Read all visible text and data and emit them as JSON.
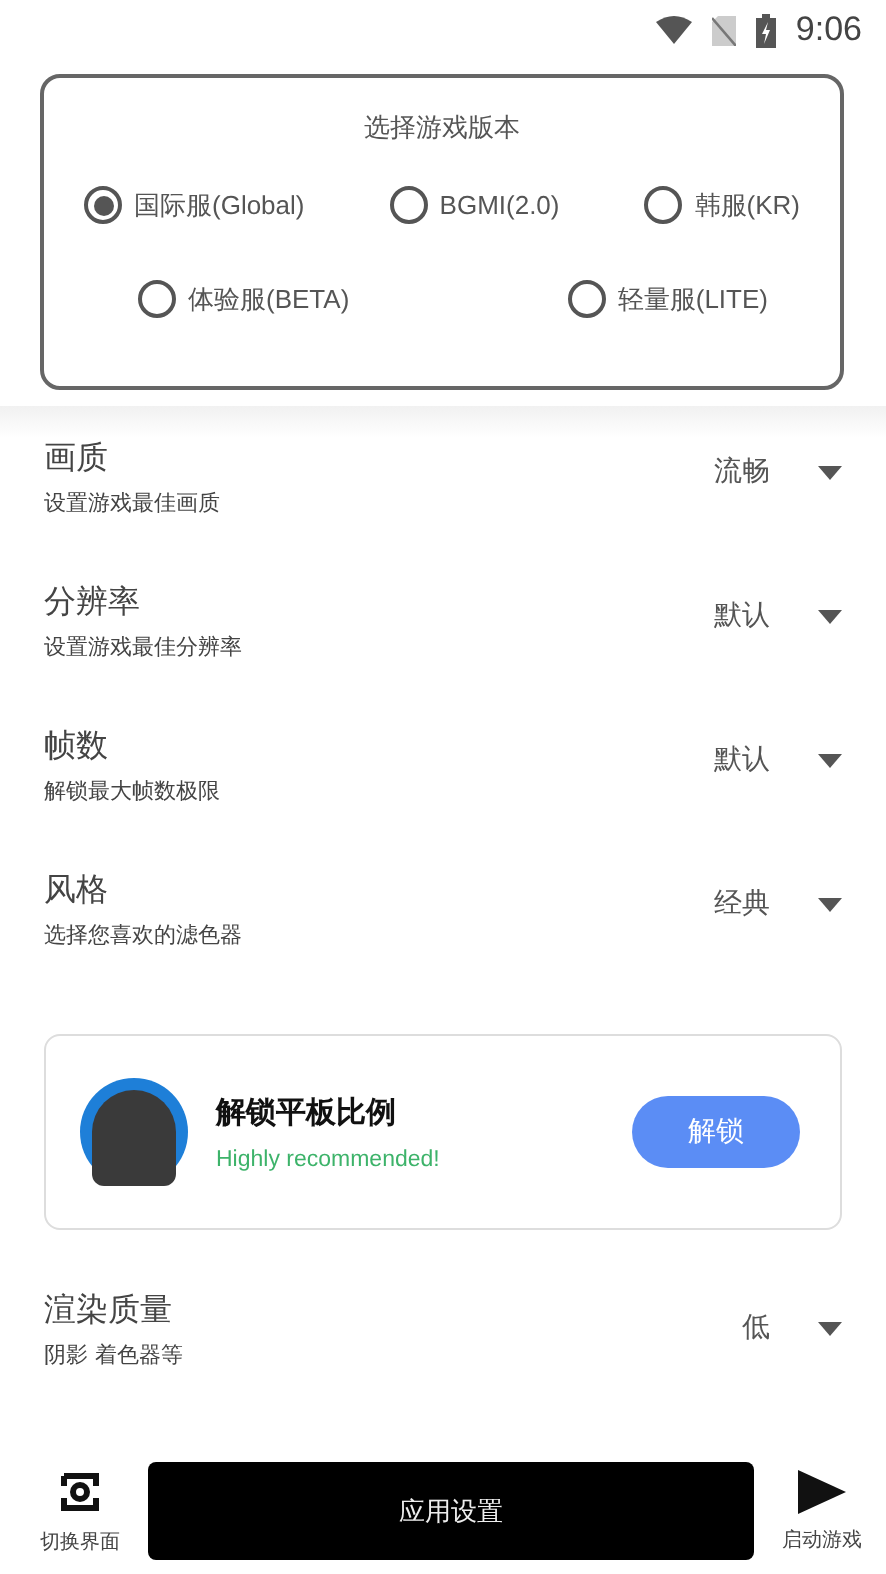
{
  "status_bar": {
    "time": "9:06"
  },
  "version_card": {
    "title": "选择游戏版本",
    "options": [
      {
        "label": "国际服(Global)",
        "selected": true
      },
      {
        "label": "BGMI(2.0)",
        "selected": false
      },
      {
        "label": "韩服(KR)",
        "selected": false
      },
      {
        "label": "体验服(BETA)",
        "selected": false
      },
      {
        "label": "轻量服(LITE)",
        "selected": false
      }
    ]
  },
  "settings": [
    {
      "title": "画质",
      "subtitle": "设置游戏最佳画质",
      "value": "流畅"
    },
    {
      "title": "分辨率",
      "subtitle": "设置游戏最佳分辨率",
      "value": "默认"
    },
    {
      "title": "帧数",
      "subtitle": "解锁最大帧数极限",
      "value": "默认"
    },
    {
      "title": "风格",
      "subtitle": "选择您喜欢的滤色器",
      "value": "经典"
    }
  ],
  "promo": {
    "title": "解锁平板比例",
    "subtitle": "Highly recommended!",
    "button": "解锁"
  },
  "render_setting": {
    "title": "渲染质量",
    "subtitle": "阴影 着色器等",
    "value": "低"
  },
  "bottom_bar": {
    "switch_label": "切换界面",
    "apply_button": "应用设置",
    "start_label": "启动游戏"
  }
}
